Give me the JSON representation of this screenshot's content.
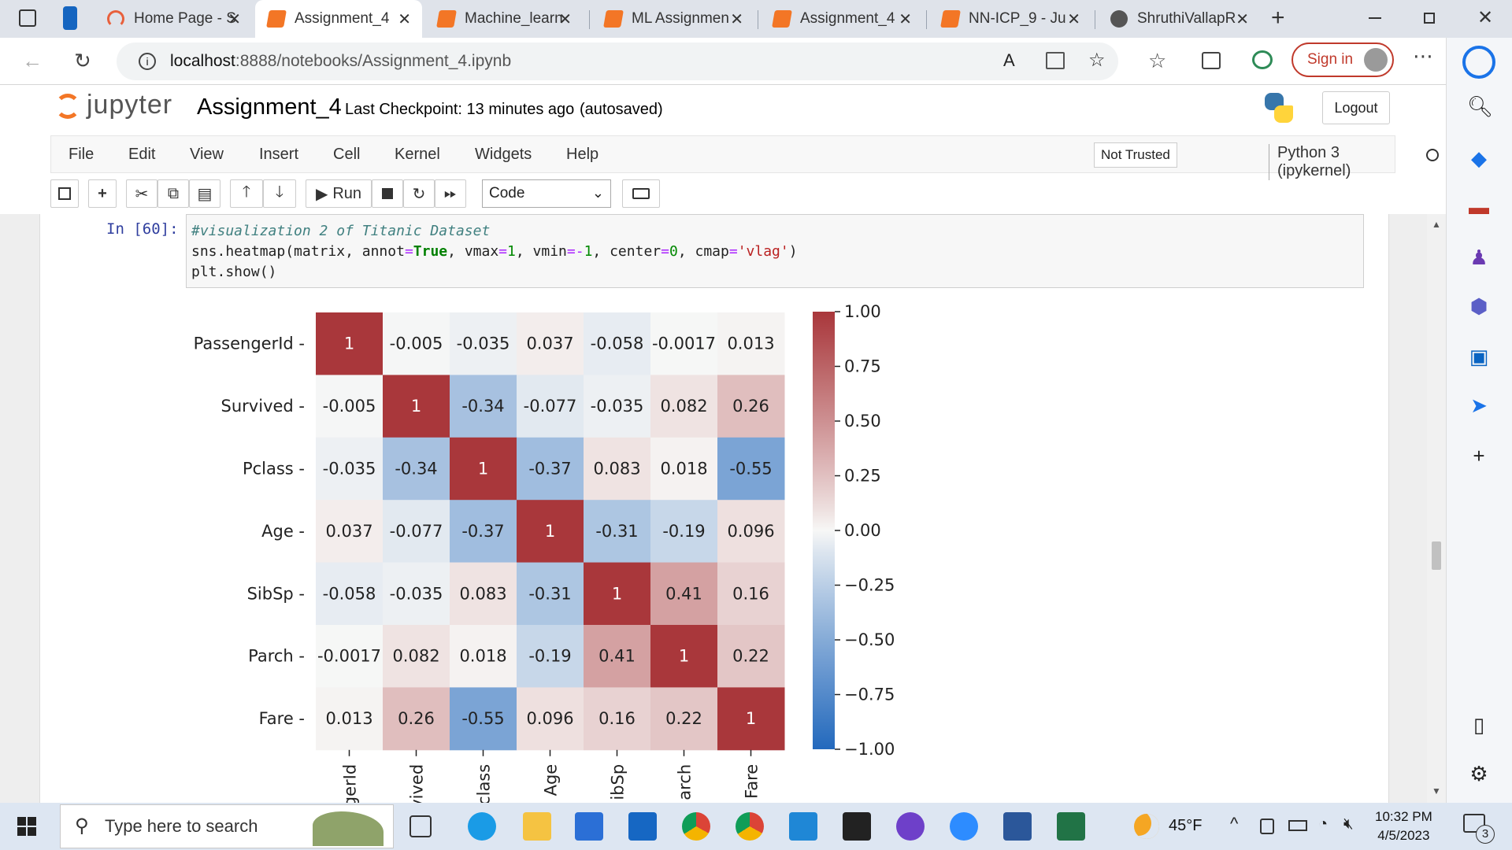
{
  "browser": {
    "tabs": [
      {
        "title": "Home Page - S",
        "active": false
      },
      {
        "title": "Assignment_4",
        "active": true
      },
      {
        "title": "Machine_learn",
        "active": false
      },
      {
        "title": "ML Assignmen",
        "active": false
      },
      {
        "title": "Assignment_4",
        "active": false
      },
      {
        "title": "NN-ICP_9 - Ju",
        "active": false
      },
      {
        "title": "ShruthiVallapR",
        "active": false
      }
    ],
    "url_host": "localhost",
    "url_path": ":8888/notebooks/Assignment_4.ipynb",
    "sign_in_label": "Sign in"
  },
  "jupyter": {
    "logo_text": "jupyter",
    "notebook_name": "Assignment_4",
    "checkpoint": "Last Checkpoint: 13 minutes ago",
    "autosave": "(autosaved)",
    "logout_label": "Logout",
    "menu": [
      "File",
      "Edit",
      "View",
      "Insert",
      "Cell",
      "Kernel",
      "Widgets",
      "Help"
    ],
    "trust_label": "Not Trusted",
    "kernel_name": "Python 3 (ipykernel)",
    "run_label": "Run",
    "cell_type": "Code"
  },
  "cell": {
    "prompt": "In [60]:",
    "code_lines": [
      "#visualization 2 of Titanic Dataset",
      "sns.heatmap(matrix, annot=True, vmax=1, vmin=-1, center=0, cmap='vlag')",
      "plt.show()"
    ]
  },
  "chart_data": {
    "type": "heatmap",
    "title": "",
    "rows": [
      "PassengerId",
      "Survived",
      "Pclass",
      "Age",
      "SibSp",
      "Parch",
      "Fare"
    ],
    "columns": [
      "PassengerId",
      "Survived",
      "Pclass",
      "Age",
      "SibSp",
      "Parch",
      "Fare"
    ],
    "column_labels_visible": [
      "gerId",
      "vived",
      "class",
      "Age",
      "ibSp",
      "arch",
      "Fare"
    ],
    "values": [
      [
        1,
        -0.005,
        -0.035,
        0.037,
        -0.058,
        -0.0017,
        0.013
      ],
      [
        -0.005,
        1,
        -0.34,
        -0.077,
        -0.035,
        0.082,
        0.26
      ],
      [
        -0.035,
        -0.34,
        1,
        -0.37,
        0.083,
        0.018,
        -0.55
      ],
      [
        0.037,
        -0.077,
        -0.37,
        1,
        -0.31,
        -0.19,
        0.096
      ],
      [
        -0.058,
        -0.035,
        0.083,
        -0.31,
        1,
        0.41,
        0.16
      ],
      [
        -0.0017,
        0.082,
        0.018,
        -0.19,
        0.41,
        1,
        0.22
      ],
      [
        0.013,
        0.26,
        -0.55,
        0.096,
        0.16,
        0.22,
        1
      ]
    ],
    "annotations": [
      [
        "1",
        "-0.005",
        "-0.035",
        "0.037",
        "-0.058",
        "-0.0017",
        "0.013"
      ],
      [
        "-0.005",
        "1",
        "-0.34",
        "-0.077",
        "-0.035",
        "0.082",
        "0.26"
      ],
      [
        "-0.035",
        "-0.34",
        "1",
        "-0.37",
        "0.083",
        "0.018",
        "-0.55"
      ],
      [
        "0.037",
        "-0.077",
        "-0.37",
        "1",
        "-0.31",
        "-0.19",
        "0.096"
      ],
      [
        "-0.058",
        "-0.035",
        "0.083",
        "-0.31",
        "1",
        "0.41",
        "0.16"
      ],
      [
        "-0.0017",
        "0.082",
        "0.018",
        "-0.19",
        "0.41",
        "1",
        "0.22"
      ],
      [
        "0.013",
        "0.26",
        "-0.55",
        "0.096",
        "0.16",
        "0.22",
        "1"
      ]
    ],
    "vmin": -1,
    "vmax": 1,
    "center": 0,
    "colormap": "vlag",
    "colorbar_ticks": [
      1.0,
      0.75,
      0.5,
      0.25,
      0.0,
      -0.25,
      -0.5,
      -0.75,
      -1.0
    ],
    "colorbar_tick_labels": [
      "1.00",
      "0.75",
      "0.50",
      "0.25",
      "0.00",
      "−0.25",
      "−0.50",
      "−0.75",
      "−1.00"
    ],
    "colors": {
      "high": "#a9373b",
      "mid": "#f7f7f6",
      "low": "#2369bd"
    }
  },
  "taskbar": {
    "search_placeholder": "Type here to search",
    "weather": "45°F",
    "time": "10:32 PM",
    "date": "4/5/2023",
    "notifications": "3"
  }
}
